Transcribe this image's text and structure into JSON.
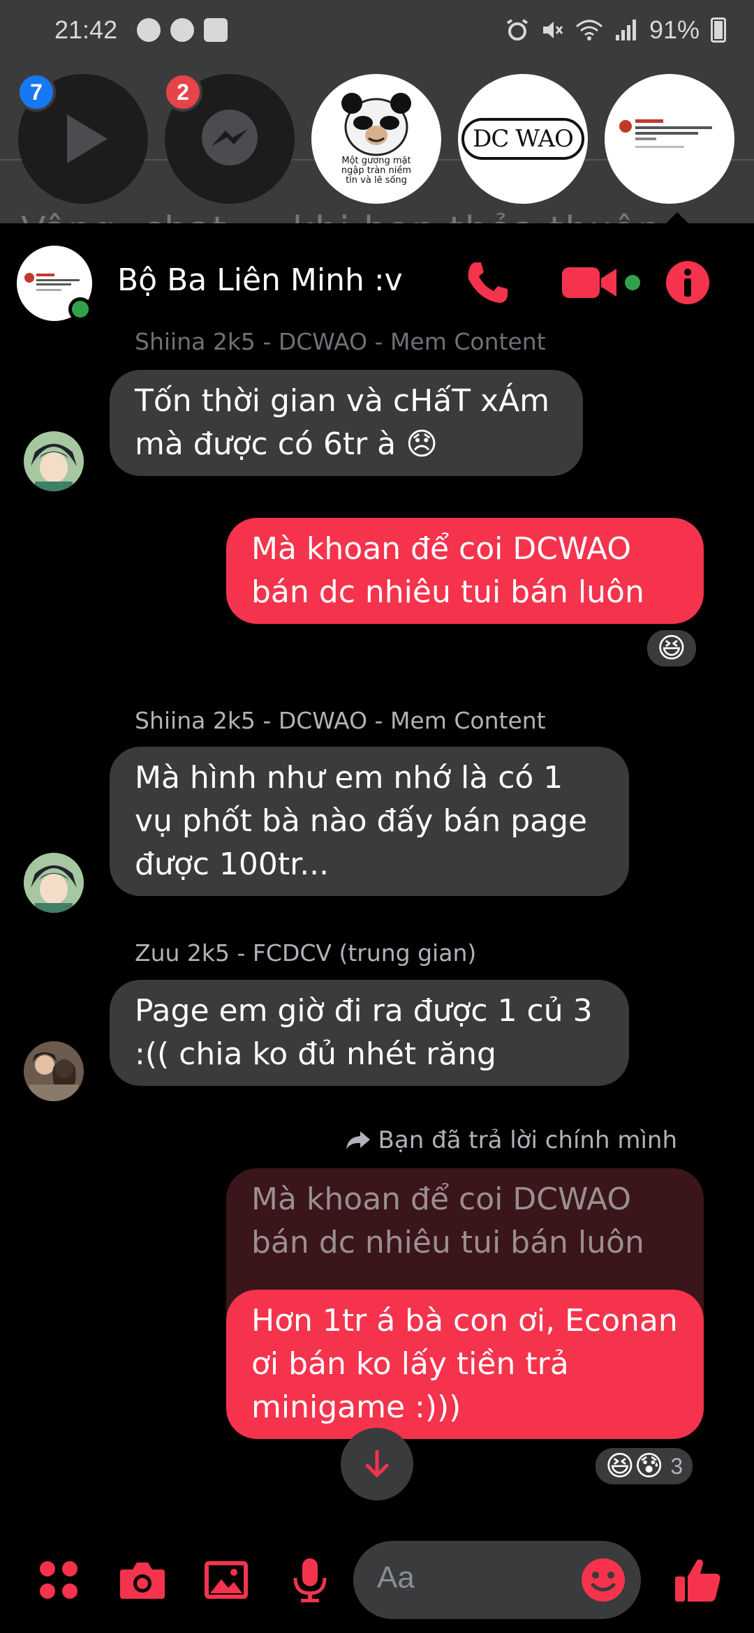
{
  "status_bar": {
    "time": "21:42",
    "battery": "91%"
  },
  "chat_heads": [
    {
      "name": "video-player-head",
      "badge": "7",
      "badge_color": "#1877f2"
    },
    {
      "name": "messenger-head",
      "badge": "2",
      "badge_color": "#e4444a"
    },
    {
      "name": "meme-head",
      "caption": "Một gương mặt ngập tràn niềm tin và lẽ sống"
    },
    {
      "name": "dcwao-logo-head",
      "logo_text": "DC WAO"
    },
    {
      "name": "group-preview-head"
    }
  ],
  "background_text": "Vâng, chat ... khi bạn thỏa thuận",
  "header": {
    "title": "Bộ Ba Liên Minh :v",
    "accent_color": "#f5334d",
    "online_color": "#31a24c"
  },
  "messages": {
    "top_sender": "Shiina 2k5 - DCWAO - Mem Content",
    "m1": "Tốn thời gian và cHấT xÁm mà được có 6tr à 😞",
    "m2": "Mà khoan để coi DCWAO bán dc nhiêu tui bán luôn",
    "m2_reaction": "😆",
    "sender_2": "Shiina 2k5 - DCWAO - Mem Content",
    "m3": "Mà hình như em nhớ là có 1 vụ phốt bà nào đấy bán page được 100tr...",
    "sender_3": "Zuu 2k5 - FCDCV (trung gian)",
    "m4": "Page em giờ đi ra được 1 củ 3 :(( chia ko đủ nhét răng",
    "replied_note": "Bạn đã trả lời chính mình",
    "m5_quote": "Mà khoan để coi DCWAO bán dc nhiêu tui bán luôn",
    "m5": "Hơn 1tr á bà con ơi, Econan ơi bán ko lấy tiền trả minigame :)))",
    "m5_reactions": "😆😰",
    "m5_reaction_count": "3"
  },
  "composer": {
    "placeholder": "Aa"
  }
}
